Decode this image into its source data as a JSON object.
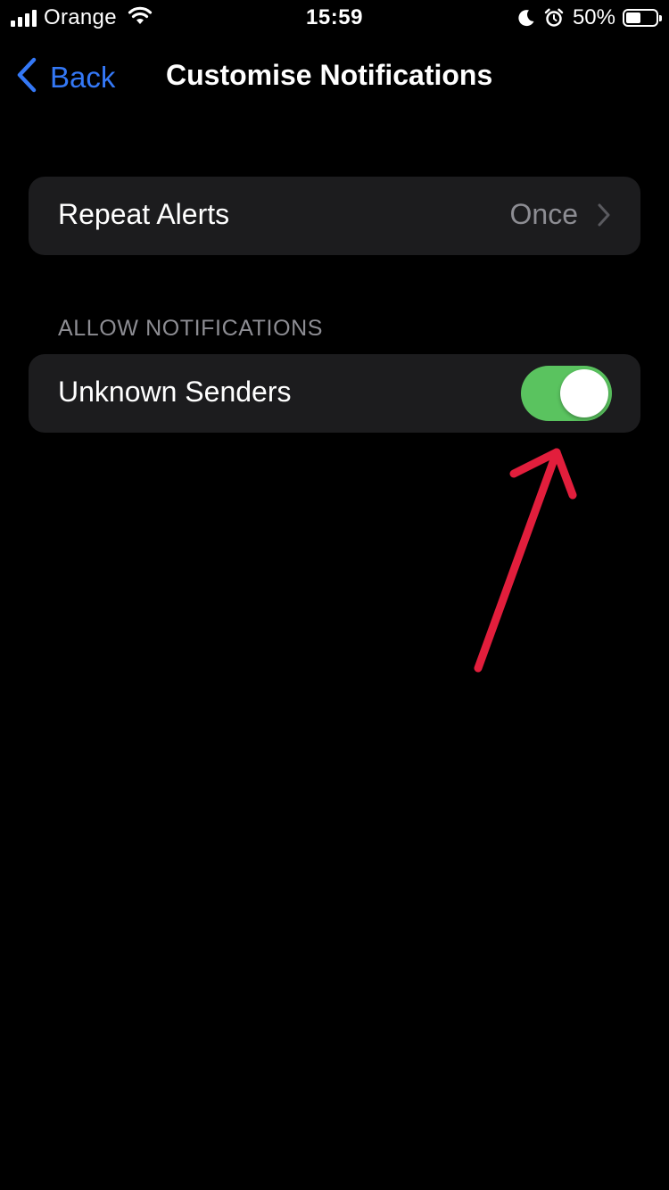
{
  "status_bar": {
    "carrier": "Orange",
    "time": "15:59",
    "battery_percent": "50%",
    "battery_level": 0.5,
    "icons": [
      "signal-icon",
      "wifi-icon",
      "moon-icon",
      "alarm-icon",
      "battery-icon"
    ]
  },
  "nav": {
    "back_label": "Back",
    "title": "Customise Notifications"
  },
  "repeat_alerts": {
    "label": "Repeat Alerts",
    "value": "Once"
  },
  "allow_notifications": {
    "header": "ALLOW NOTIFICATIONS",
    "unknown_senders": {
      "label": "Unknown Senders",
      "enabled": true
    }
  },
  "colors": {
    "accent_blue": "#3478f6",
    "toggle_on": "#5ac35f",
    "annotation_arrow": "#e21e3c"
  }
}
